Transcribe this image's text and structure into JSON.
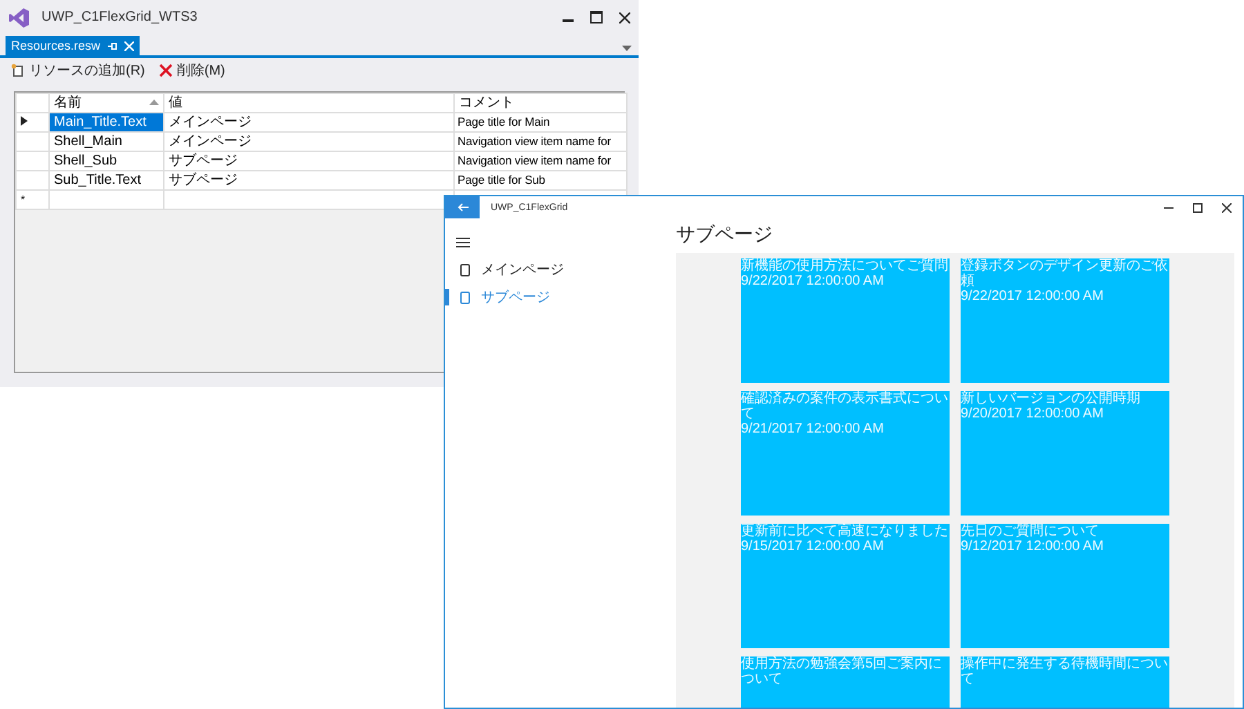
{
  "vs_window": {
    "title": "UWP_C1FlexGrid_WTS3",
    "tab": {
      "label": "Resources.resw"
    },
    "toolbar": [
      {
        "kind": "add",
        "label": "リソースの追加(R)"
      },
      {
        "kind": "delete",
        "label": "削除(M)"
      }
    ],
    "table": {
      "columns": [
        "名前",
        "値",
        "コメント"
      ],
      "rows": [
        {
          "name": "Main_Title.Text",
          "value": "メインページ",
          "comment": "Page title for Main",
          "selected": true
        },
        {
          "name": "Shell_Main",
          "value": "メインページ",
          "comment": "Navigation view item name for",
          "selected": false
        },
        {
          "name": "Shell_Sub",
          "value": "サブページ",
          "comment": "Navigation view item name for",
          "selected": false
        },
        {
          "name": "Sub_Title.Text",
          "value": "サブページ",
          "comment": "Page title for Sub",
          "selected": false
        }
      ],
      "new_row_marker": "*"
    }
  },
  "app_window": {
    "title": "UWP_C1FlexGrid",
    "nav_items": [
      {
        "label": "メインページ",
        "selected": false
      },
      {
        "label": "サブページ",
        "selected": true
      }
    ],
    "page_title": "サブページ",
    "cards": [
      {
        "title": "新機能の使用方法についてご質問",
        "date": "9/22/2017 12:00:00 AM"
      },
      {
        "title": "登録ボタンのデザイン更新のご依頼",
        "date": "9/22/2017 12:00:00 AM"
      },
      {
        "title": "確認済みの案件の表示書式について",
        "date": "9/21/2017 12:00:00 AM"
      },
      {
        "title": "新しいバージョンの公開時期",
        "date": "9/20/2017 12:00:00 AM"
      },
      {
        "title": "更新前に比べて高速になりました",
        "date": "9/15/2017 12:00:00 AM"
      },
      {
        "title": "先日のご質問について",
        "date": "9/12/2017 12:00:00 AM"
      },
      {
        "title": "使用方法の勉強会第5回ご案内について"
      },
      {
        "title": "操作中に発生する待機時間について"
      }
    ]
  }
}
